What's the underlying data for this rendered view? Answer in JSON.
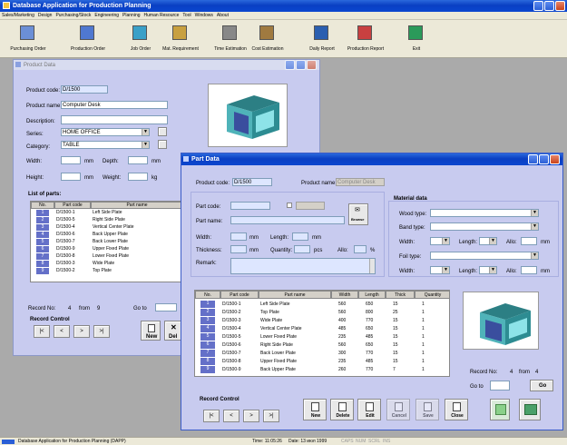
{
  "app": {
    "title": "Database Application for Production Planning",
    "menu": [
      "Sales/Marketing",
      "Design",
      "Purchasing/Stock",
      "Engineering",
      "Planning",
      "Human Resource",
      "Tool",
      "Windows",
      "About"
    ],
    "toolbar": [
      "Purchasing Order",
      "Production Order",
      "Job Order",
      "Mat. Requirement",
      "Time Estimation",
      "Cost Estimation",
      "Daily Report",
      "Production Report",
      "Exit"
    ],
    "status": {
      "left": "Database Application for Production Planning (DAPP)",
      "time": "Time: 11:05:26",
      "date": "Date: 13 июл 1999",
      "caps": "CAPS",
      "num": "NUM",
      "scrl": "SCRL",
      "ins": "INS"
    }
  },
  "product": {
    "title": "Product Data",
    "code_label": "Product code:",
    "code_value": "D/1500",
    "name_label": "Product name:",
    "name_value": "Computer Desk",
    "desc_label": "Description:",
    "series_label": "Series:",
    "series_value": "HOME OFFICE",
    "category_label": "Category:",
    "category_value": "TABLE",
    "width_label": "Width:",
    "depth_label": "Depth:",
    "height_label": "Height:",
    "weight_label": "Weight:",
    "unit_mm": "mm",
    "unit_kg": "kg",
    "list_title": "List of parts:",
    "cols": [
      "No.",
      "Part code",
      "Part name"
    ],
    "rows": [
      [
        "1",
        "D/1500-1",
        "Left Side Plate"
      ],
      [
        "2",
        "D/1500-5",
        "Right Side Plate"
      ],
      [
        "3",
        "D/1500-4",
        "Vertical Center Plate"
      ],
      [
        "4",
        "D/1500-6",
        "Back Upper Plate"
      ],
      [
        "5",
        "D/1500-7",
        "Back Lower Plate"
      ],
      [
        "6",
        "D/1500-9",
        "Upper Fixed Plate"
      ],
      [
        "7",
        "D/1500-8",
        "Lower Fixed Plate"
      ],
      [
        "8",
        "D/1500-3",
        "Wide Plate"
      ],
      [
        "9",
        "D/1500-2",
        "Top Plate"
      ]
    ],
    "record_no": "Record No:",
    "record_n": "4",
    "from": "from",
    "from_n": "9",
    "goto": "Go to",
    "record_control": "Record Control",
    "btn_new": "New",
    "btn_del": "Del"
  },
  "part": {
    "title": "Part Data",
    "code_label": "Product code:",
    "code_value": "D/1500",
    "pname_label": "Product name:",
    "pname_value": "Computer Desk",
    "partcode_label": "Part code:",
    "partname_label": "Part name:",
    "width_label": "Width:",
    "length_label": "Length:",
    "thick_label": "Thickness:",
    "qty_label": "Quantity:",
    "allo_label": "Allo:",
    "pct": "%",
    "unit_mm": "mm",
    "unit_pcs": "pcs",
    "remark_label": "Remark:",
    "browse": "Browse",
    "material_title": "Material data",
    "wood_type": "Wood type:",
    "band_type": "Band type:",
    "foil_type": "Foil type:",
    "mat_width": "Width:",
    "mat_length": "Length:",
    "mat_allo": "Allo:",
    "cols": [
      "No.",
      "Part code",
      "Part name",
      "Width",
      "Length",
      "Thick",
      "Quantity"
    ],
    "rows": [
      [
        "1",
        "D/1500-1",
        "Left Side Plate",
        "560",
        "650",
        "15",
        "1"
      ],
      [
        "2",
        "D/1500-2",
        "Top Plate",
        "560",
        "800",
        "25",
        "1"
      ],
      [
        "3",
        "D/1500-3",
        "Wide Plate",
        "400",
        "770",
        "15",
        "1"
      ],
      [
        "4",
        "D/1500-4",
        "Vertical Center Plate",
        "485",
        "650",
        "15",
        "1"
      ],
      [
        "5",
        "D/1500-5",
        "Lower Fixed Plate",
        "235",
        "485",
        "15",
        "1"
      ],
      [
        "6",
        "D/1500-6",
        "Right Side Plate",
        "560",
        "650",
        "15",
        "1"
      ],
      [
        "7",
        "D/1500-7",
        "Back Lower Plate",
        "300",
        "770",
        "15",
        "1"
      ],
      [
        "8",
        "D/1500-8",
        "Upper Fixed Plate",
        "235",
        "485",
        "15",
        "1"
      ],
      [
        "9",
        "D/1500-9",
        "Back Upper Plate",
        "260",
        "770",
        "7",
        "1"
      ]
    ],
    "record_no": "Record No:",
    "record_n": "4",
    "from": "from",
    "from_n": "4",
    "goto": "Go to",
    "go_btn": "Go",
    "record_control": "Record Control",
    "actions": [
      "New",
      "Delete",
      "Edit",
      "Cancel",
      "Save",
      "Close"
    ]
  }
}
